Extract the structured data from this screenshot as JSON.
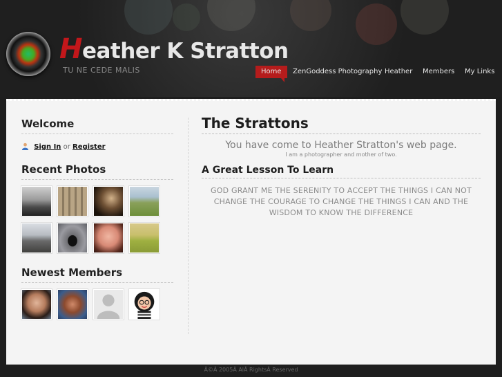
{
  "site": {
    "title_initial": "H",
    "title_rest": "eather K Stratton",
    "tagline": "TU NE CEDE MALIS"
  },
  "nav": {
    "items": [
      {
        "label": "Home",
        "active": true
      },
      {
        "label": "ZenGoddess Photography",
        "active": false
      },
      {
        "label": "Heather",
        "active": false
      },
      {
        "label": "Members",
        "active": false
      },
      {
        "label": "My Links",
        "active": false
      }
    ]
  },
  "sidebar": {
    "welcome_heading": "Welcome",
    "signin_label": "Sign In",
    "or_text": "or",
    "register_label": "Register",
    "recent_photos_heading": "Recent Photos",
    "newest_members_heading": "Newest Members"
  },
  "main": {
    "title": "The Strattons",
    "intro": "You have come to Heather Stratton's web page.",
    "intro_sub": "I am a photographer and mother of two.",
    "lesson_heading": "A Great Lesson To Learn",
    "lesson_text": "GOD GRANT ME THE SERENITY TO ACCEPT THE THINGS I CAN NOT CHANGE THE COURAGE TO CHANGE THE THINGS I CAN AND THE WISDOM TO KNOW THE DIFFERENCE"
  },
  "footer": {
    "text": "Â©Â 2005Â AlÂ RightsÂ Reserved"
  },
  "colors": {
    "accent": "#b51c1c",
    "header_bg": "#1d1d1d",
    "content_bg": "#f4f4f4"
  }
}
